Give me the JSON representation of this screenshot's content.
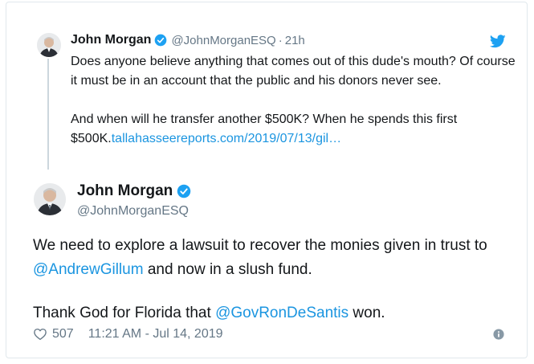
{
  "reply_tweet": {
    "author_name": "John Morgan",
    "author_handle": "@JohnMorganESQ",
    "separator": "·",
    "time": "21h",
    "text_line_1": "Does anyone believe anything that comes out of this dude's mouth? Of course it must be in an account that the public and his donors never see.",
    "text_line_2_prefix": "And when will he transfer another $500K? When he spends this first $500K.",
    "link_text": "tallahasseereports.com/2019/07/13/gil…"
  },
  "main_tweet": {
    "author_name": "John Morgan",
    "author_handle": "@JohnMorganESQ",
    "para1_prefix": "We need to explore a lawsuit to recover the monies given in trust to ",
    "para1_mention": "@AndrewGillum",
    "para1_suffix": " and now in a slush fund.",
    "para2_prefix": "Thank God for Florida that ",
    "para2_mention": "@GovRonDeSantis",
    "para2_suffix": " won.",
    "like_count": "507",
    "timestamp": "11:21 AM - Jul 14, 2019"
  },
  "icons": {
    "verified": "verified-badge-icon",
    "bird": "twitter-bird-icon",
    "heart": "heart-icon",
    "info": "info-icon"
  },
  "colors": {
    "accent": "#1da1f2",
    "link": "#1b95e0",
    "muted": "#657786",
    "text": "#14171a",
    "border": "#e1e8ed"
  }
}
